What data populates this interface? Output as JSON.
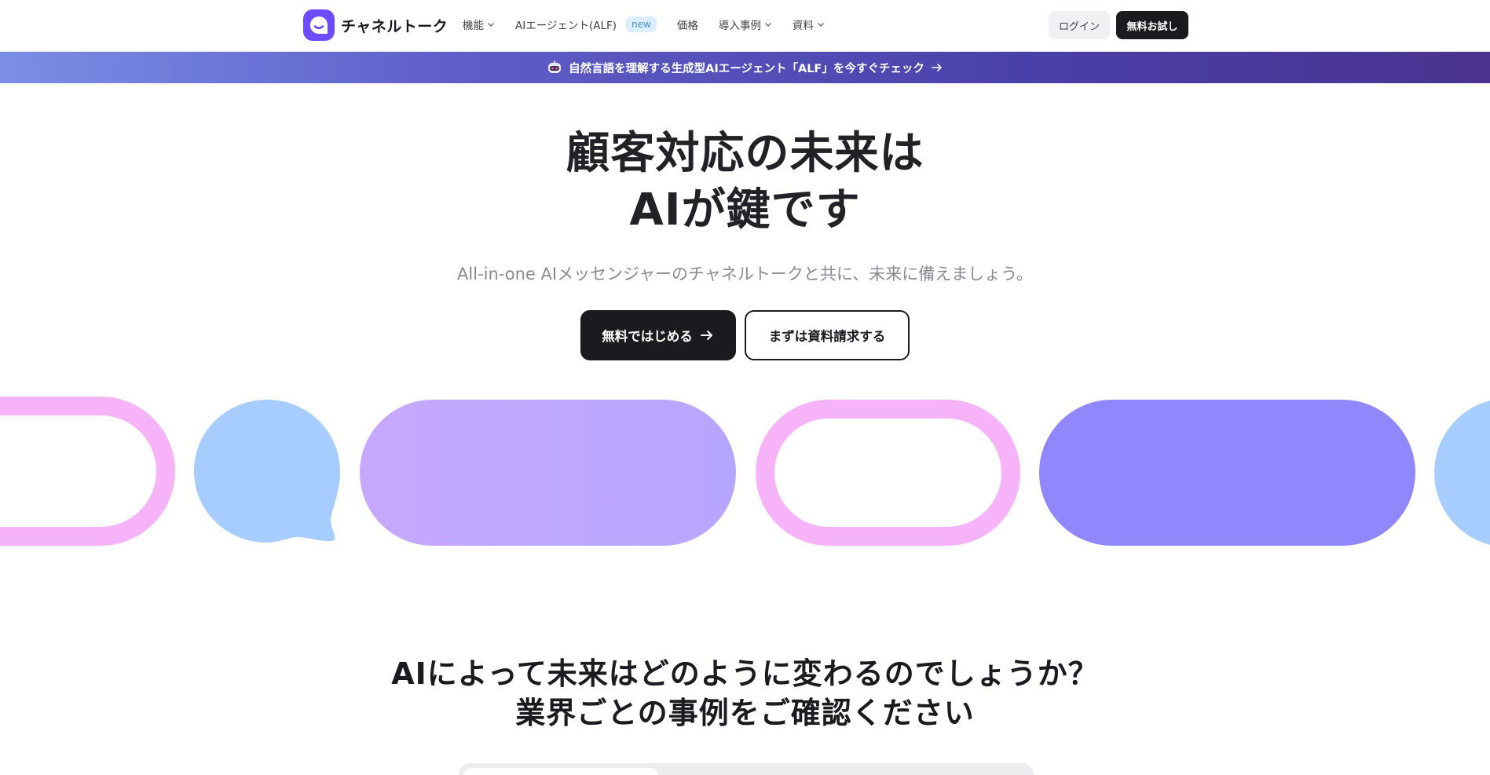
{
  "header": {
    "logo_text": "チャネルトーク",
    "nav": [
      {
        "label": "機能",
        "has_dropdown": true
      },
      {
        "label": "AIエージェント(ALF)",
        "badge": "new",
        "has_dropdown": false
      },
      {
        "label": "価格",
        "has_dropdown": false
      },
      {
        "label": "導入事例",
        "has_dropdown": true
      },
      {
        "label": "資料",
        "has_dropdown": true
      }
    ],
    "login_label": "ログイン",
    "trial_label": "無料お試し"
  },
  "banner": {
    "text": "自然言語を理解する生成型AIエージェント「ALF」を今すぐチェック"
  },
  "hero": {
    "title_line1": "顧客対応の未来は",
    "title_line2": "AIが鍵です",
    "subtitle": "All-in-one AIメッセンジャーのチャネルトークと共に、未来に備えましょう。",
    "cta_primary": "無料ではじめる",
    "cta_secondary": "まずは資料請求する"
  },
  "section": {
    "title_line1": "AIによって未来はどのように変わるのでしょうか？",
    "title_line2": "業界ごとの事例をご確認ください"
  },
  "colors": {
    "brand": "#6b4cff",
    "pink": "#f6b3f8",
    "blue": "#a6cdfd",
    "lavender": "#c1a8ff",
    "violet": "#8f87fb",
    "dark": "#1b1b1f"
  }
}
